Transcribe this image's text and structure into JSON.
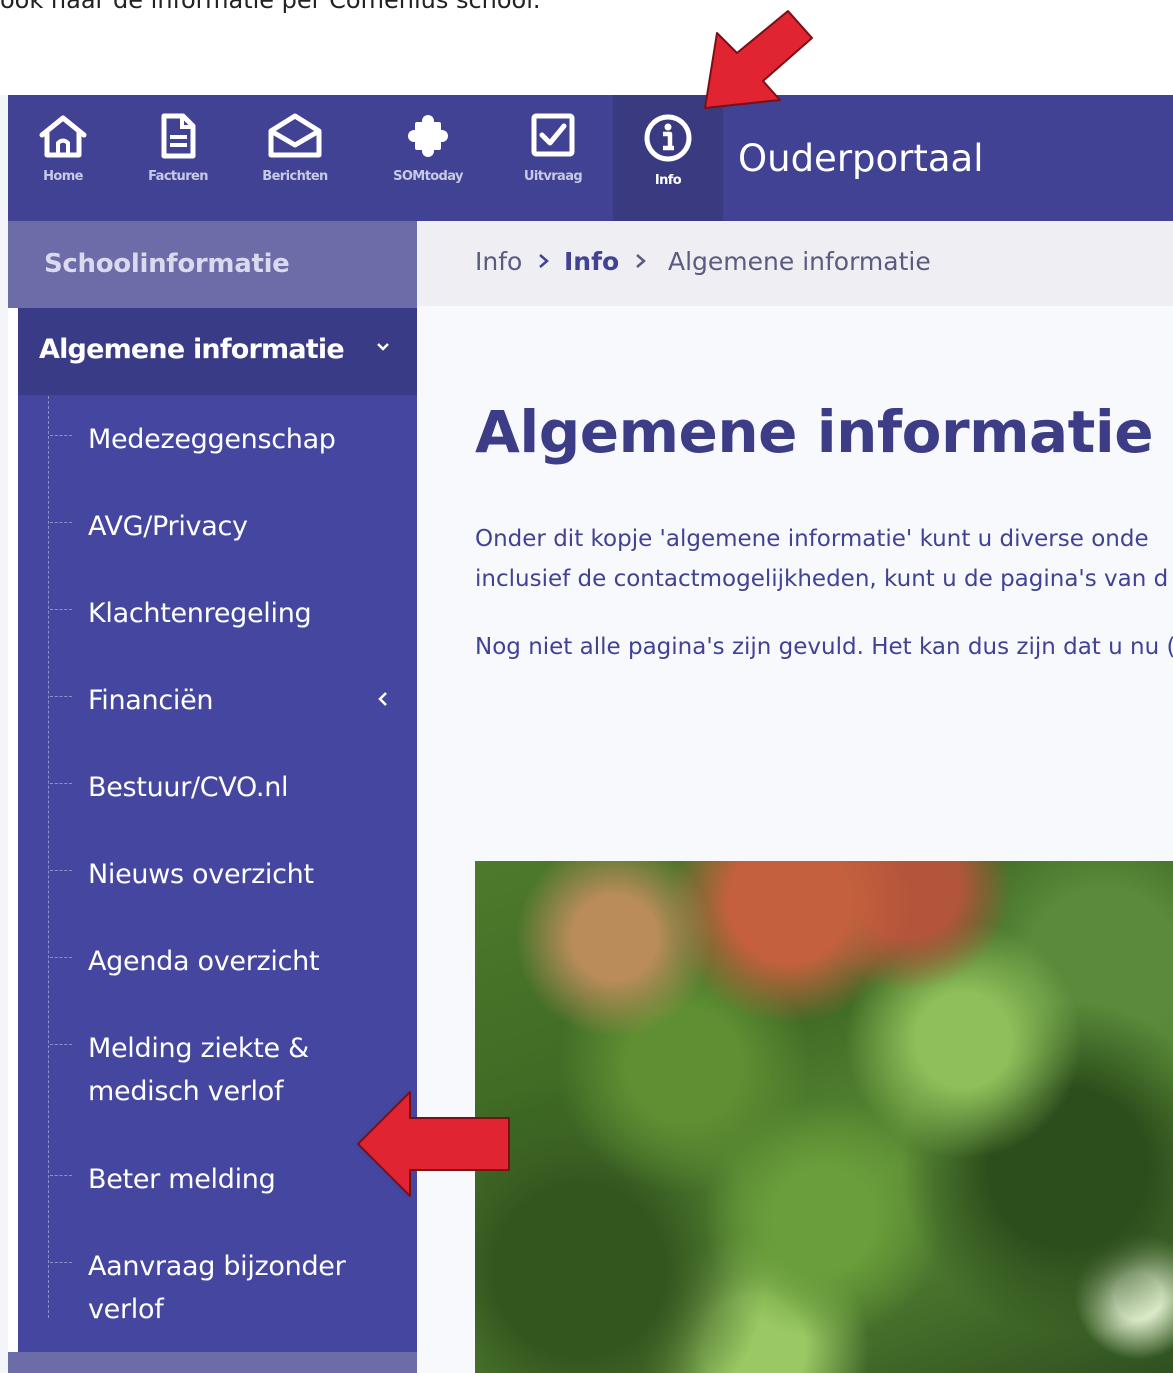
{
  "caption": "ook naar de informatie per Comenius school.",
  "topbar": {
    "title": "Ouderportaal",
    "nav": [
      {
        "label": "Home",
        "icon": "home-icon"
      },
      {
        "label": "Facturen",
        "icon": "document-icon"
      },
      {
        "label": "Berichten",
        "icon": "envelope-icon"
      },
      {
        "label": "SOMtoday",
        "icon": "puzzle-icon"
      },
      {
        "label": "Uitvraag",
        "icon": "checkbox-icon"
      },
      {
        "label": "Info",
        "icon": "info-icon",
        "active": true
      }
    ]
  },
  "sidebar": {
    "header": "Schoolinformatie",
    "active_item": "Algemene informatie",
    "items": [
      {
        "label": "Medezeggenschap"
      },
      {
        "label": "AVG/Privacy"
      },
      {
        "label": "Klachtenregeling"
      },
      {
        "label": "Financiën",
        "has_children": true
      },
      {
        "label": "Bestuur/CVO.nl"
      },
      {
        "label": "Nieuws overzicht"
      },
      {
        "label": "Agenda overzicht"
      },
      {
        "label": "Melding ziekte & medisch verlof"
      },
      {
        "label": "Beter melding"
      },
      {
        "label": "Aanvraag bijzonder verlof"
      }
    ]
  },
  "breadcrumb": [
    "Info",
    "Info",
    "Algemene informatie"
  ],
  "content": {
    "title": "Algemene informatie",
    "paragraph1_line1": "Onder dit kopje 'algemene informatie'  kunt u diverse onde",
    "paragraph1_line2": "inclusief de contactmogelijkheden, kunt u de pagina's van d",
    "paragraph2": "Nog niet alle pagina's zijn gevuld. Het kan dus zijn dat u nu ("
  },
  "colors": {
    "topbar": "#414293",
    "sidebar": "#4546a0",
    "annotation_arrow": "#e02431"
  }
}
